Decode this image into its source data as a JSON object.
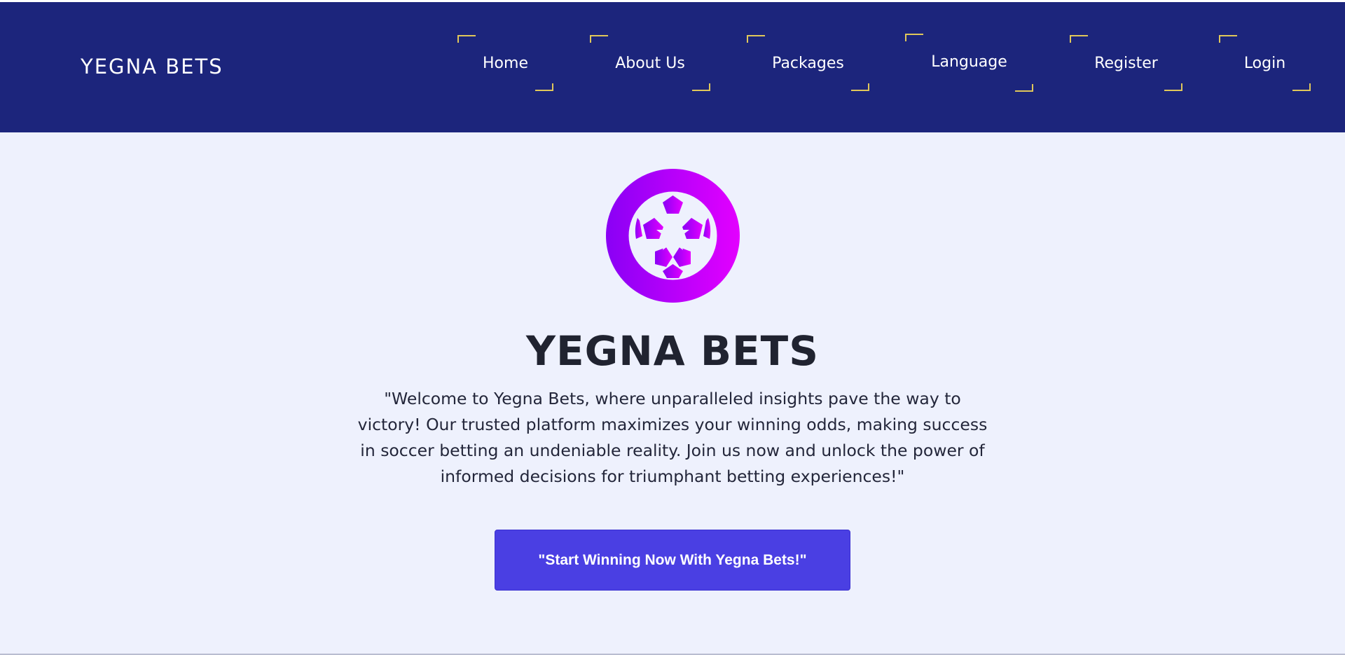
{
  "brand": {
    "name": "YEGNA BETS"
  },
  "nav": {
    "items": [
      {
        "label": "Home"
      },
      {
        "label": "About Us"
      },
      {
        "label": "Packages"
      },
      {
        "label": "Language"
      },
      {
        "label": "Register"
      },
      {
        "label": "Login"
      }
    ]
  },
  "hero": {
    "logo_icon": "soccer-ball-icon",
    "title": "YEGNA BETS",
    "text": "\"Welcome to Yegna Bets, where unparalleled insights pave the way to victory! Our trusted platform maximizes your winning odds, making success in soccer betting an undeniable reality. Join us now and unlock the power of informed decisions for triumphant betting experiences!\"",
    "cta_label": "\"Start Winning Now With Yegna Bets!\""
  },
  "colors": {
    "navbar": "#1c257c",
    "accent_corners": "#e0c75a",
    "page_background": "#eef1fd",
    "cta": "#4a3fe3",
    "logo_gradient_start": "#8a00f5",
    "logo_gradient_end": "#e300ff"
  }
}
